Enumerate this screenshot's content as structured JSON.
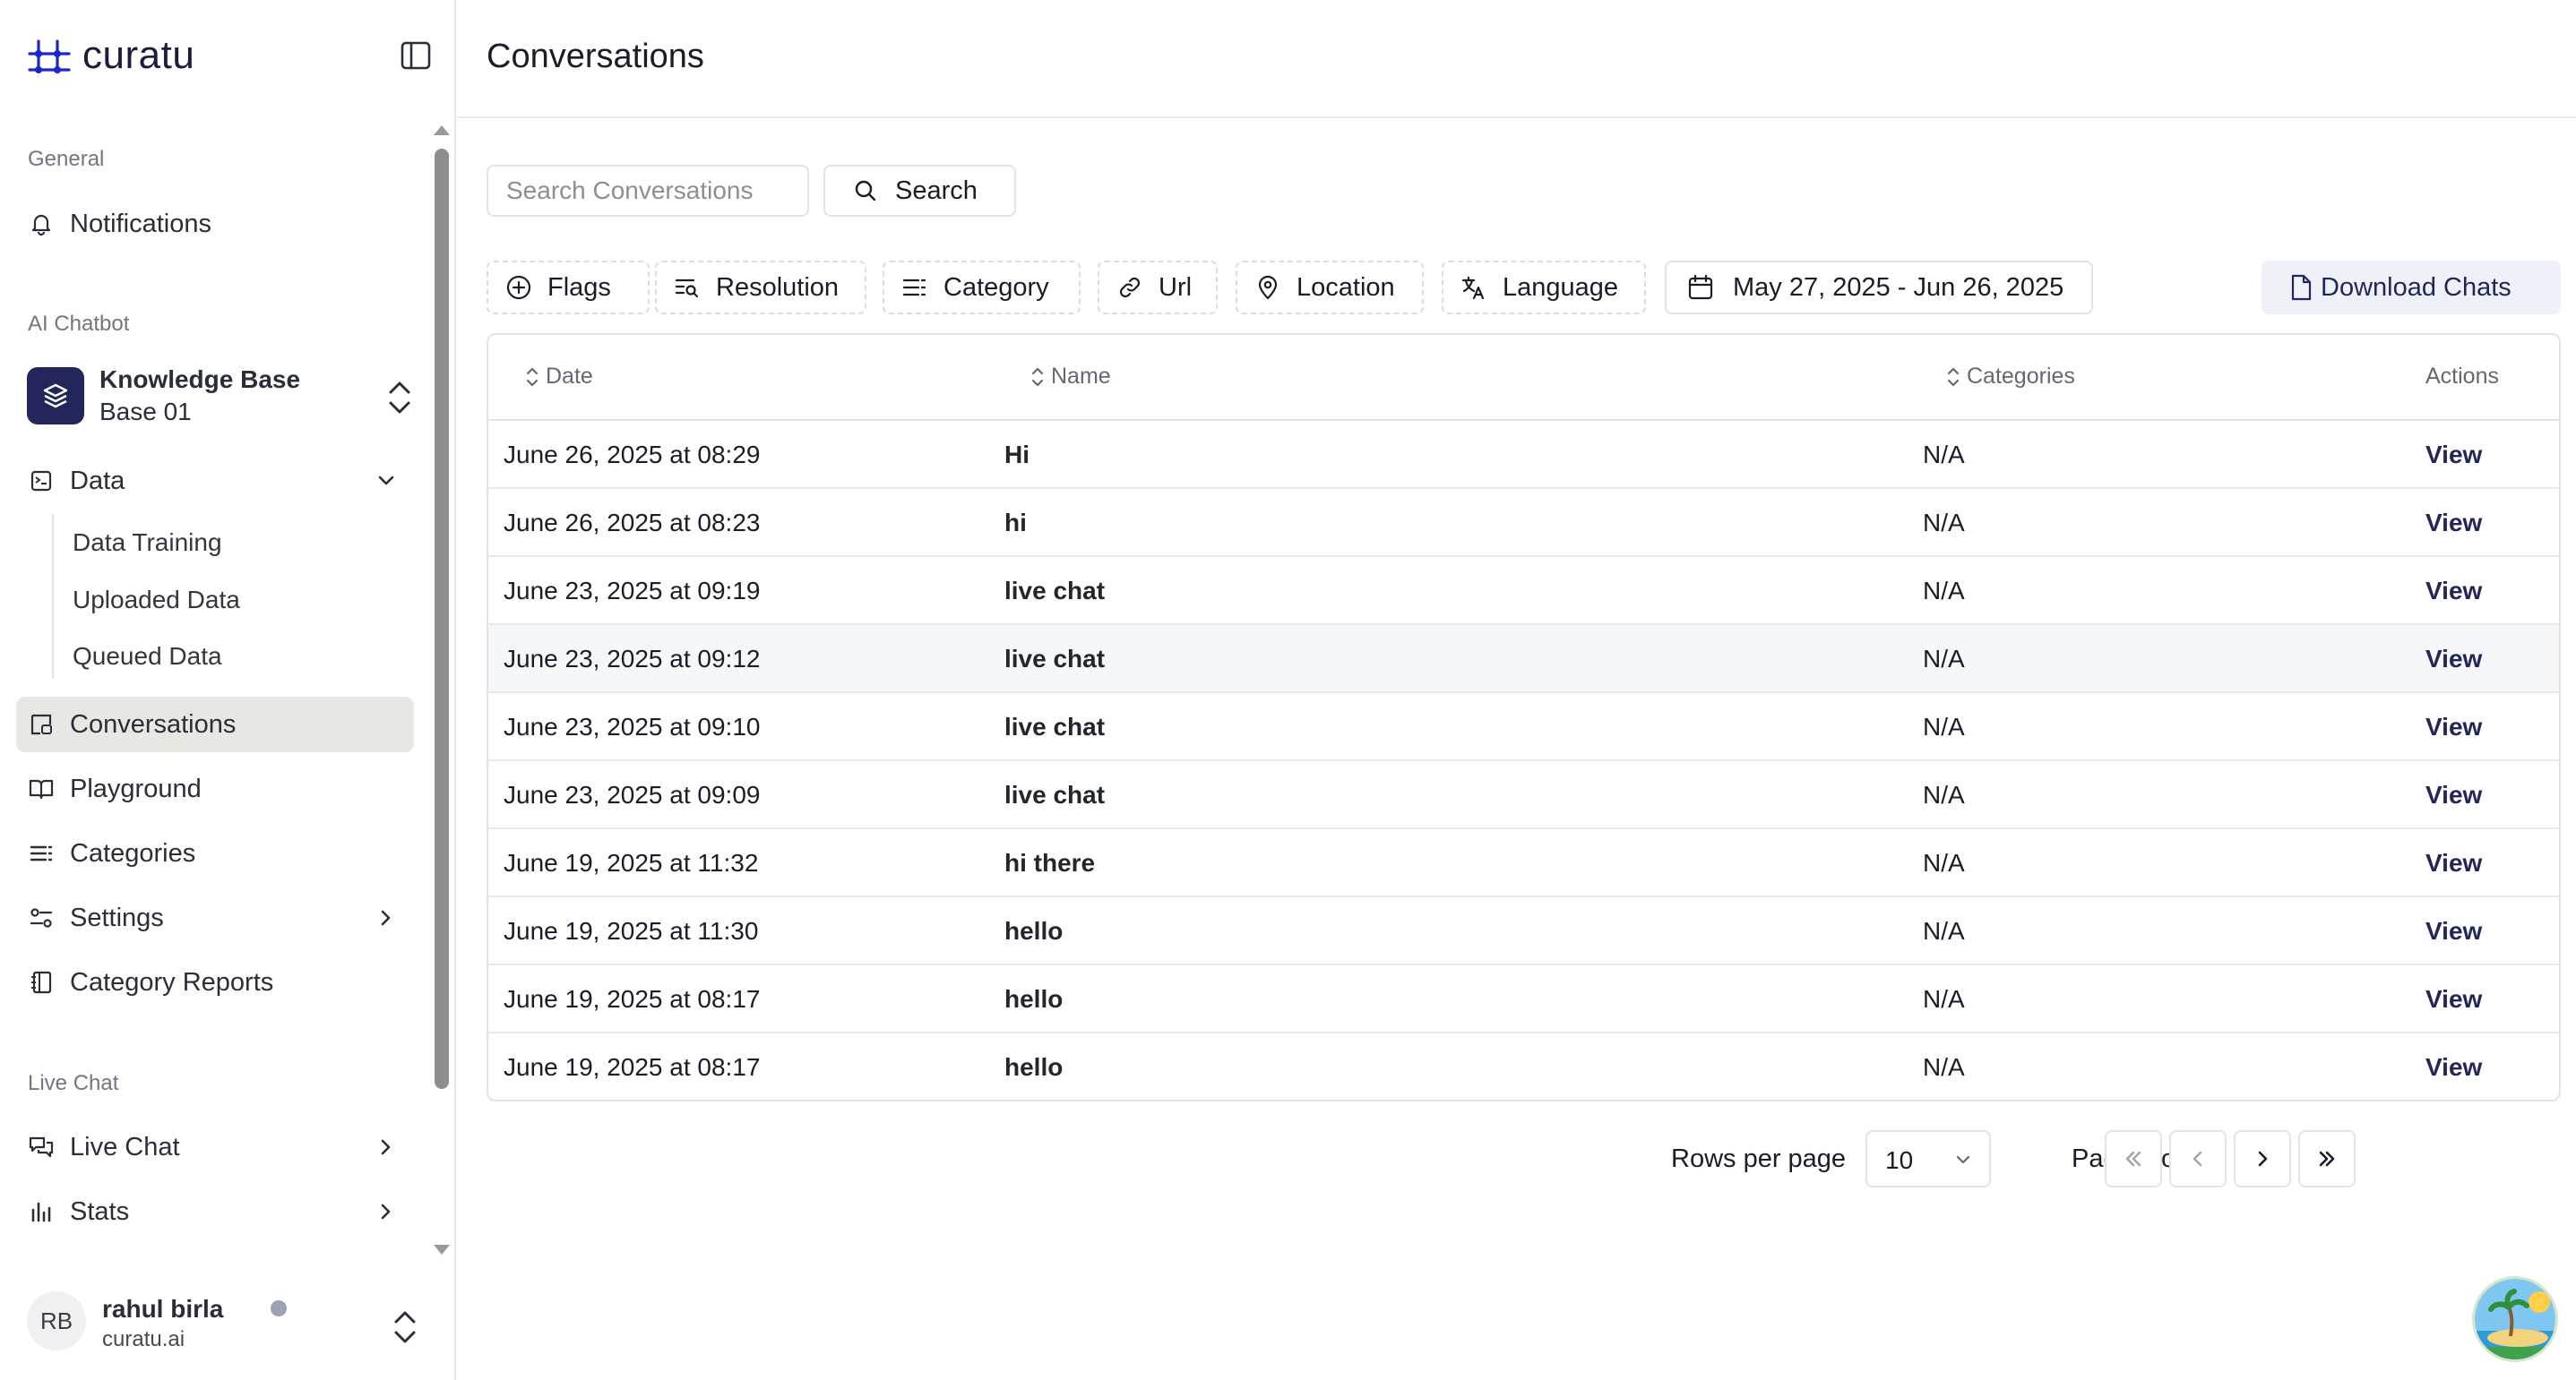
{
  "brand": {
    "name": "curatu",
    "color": "#1d27c9"
  },
  "sidebar": {
    "sections": {
      "general": "General",
      "ai_chatbot": "AI Chatbot",
      "live_chat": "Live Chat"
    },
    "notifications": "Notifications",
    "knowledge_base": {
      "title": "Knowledge Base",
      "subtitle": "Base 01"
    },
    "data": {
      "label": "Data",
      "expanded": true,
      "children": [
        "Data Training",
        "Uploaded Data",
        "Queued Data"
      ]
    },
    "conversations": "Conversations",
    "playground": "Playground",
    "categories": "Categories",
    "settings": "Settings",
    "category_reports": "Category Reports",
    "live_chat": "Live Chat",
    "stats": "Stats",
    "active_item": "Conversations"
  },
  "user": {
    "initials": "RB",
    "name": "rahul birla",
    "org": "curatu.ai"
  },
  "main": {
    "title": "Conversations",
    "search": {
      "placeholder": "Search Conversations",
      "value": "",
      "button": "Search"
    },
    "filters": {
      "flags": "Flags",
      "resolution": "Resolution",
      "category": "Category",
      "url": "Url",
      "location": "Location",
      "language": "Language"
    },
    "date_range": "May 27, 2025 - Jun 26, 2025",
    "download": "Download Chats",
    "table": {
      "columns": {
        "date": "Date",
        "name": "Name",
        "categories": "Categories",
        "actions": "Actions"
      },
      "rows": [
        {
          "date": "June 26, 2025 at 08:29",
          "name": "Hi",
          "categories": "N/A",
          "action": "View"
        },
        {
          "date": "June 26, 2025 at 08:23",
          "name": "hi",
          "categories": "N/A",
          "action": "View"
        },
        {
          "date": "June 23, 2025 at 09:19",
          "name": "live chat",
          "categories": "N/A",
          "action": "View"
        },
        {
          "date": "June 23, 2025 at 09:12",
          "name": "live chat",
          "categories": "N/A",
          "action": "View"
        },
        {
          "date": "June 23, 2025 at 09:10",
          "name": "live chat",
          "categories": "N/A",
          "action": "View"
        },
        {
          "date": "June 23, 2025 at 09:09",
          "name": "live chat",
          "categories": "N/A",
          "action": "View"
        },
        {
          "date": "June 19, 2025 at 11:32",
          "name": "hi there",
          "categories": "N/A",
          "action": "View"
        },
        {
          "date": "June 19, 2025 at 11:30",
          "name": "hello",
          "categories": "N/A",
          "action": "View"
        },
        {
          "date": "June 19, 2025 at 08:17",
          "name": "hello",
          "categories": "N/A",
          "action": "View"
        },
        {
          "date": "June 19, 2025 at 08:17",
          "name": "hello",
          "categories": "N/A",
          "action": "View"
        }
      ]
    },
    "pagination": {
      "rows_per_page_label": "Rows per page",
      "rows_per_page": "10",
      "page_info": "Page 1 of 7"
    }
  },
  "icons": {
    "collapse": "sidebar-toggle-icon",
    "notifications": "bell-icon",
    "knowledge_base": "layers-icon",
    "data": "database-icon",
    "conversations": "chat-square-icon",
    "playground": "book-open-icon",
    "categories": "list-icon",
    "settings": "sliders-icon",
    "category_reports": "notebook-icon",
    "live_chat": "messages-icon",
    "stats": "bar-chart-icon"
  },
  "colors": {
    "accent_dark": "#22265a",
    "active_bg": "#e7e7e4",
    "border": "#e2e3e8",
    "muted": "#737682"
  }
}
